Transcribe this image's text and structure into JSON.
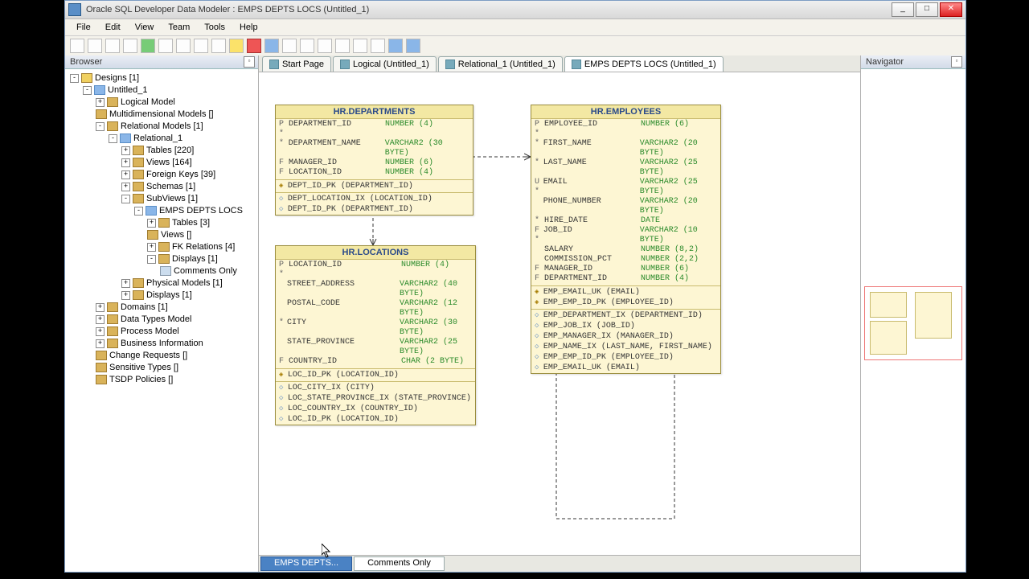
{
  "window": {
    "title": "Oracle SQL Developer Data Modeler : EMPS DEPTS LOCS (Untitled_1)"
  },
  "menu": {
    "file": "File",
    "edit": "Edit",
    "view": "View",
    "team": "Team",
    "tools": "Tools",
    "help": "Help"
  },
  "panels": {
    "browser": "Browser",
    "navigator": "Navigator"
  },
  "tabs": {
    "start": "Start Page",
    "logical": "Logical (Untitled_1)",
    "rel": "Relational_1 (Untitled_1)",
    "subv": "EMPS DEPTS LOCS (Untitled_1)"
  },
  "bottom": {
    "t1": "EMPS DEPTS...",
    "t2": "Comments Only"
  },
  "tree": {
    "designs": "Designs [1]",
    "untitled": "Untitled_1",
    "logical": "Logical Model",
    "multi": "Multidimensional Models []",
    "relmodels": "Relational Models [1]",
    "rel1": "Relational_1",
    "tables": "Tables [220]",
    "views": "Views [164]",
    "fkeys": "Foreign Keys [39]",
    "schemas": "Schemas [1]",
    "subviews": "SubViews [1]",
    "emps": "EMPS DEPTS LOCS",
    "subtables": "Tables [3]",
    "subviewsn": "Views []",
    "fkrel": "FK Relations [4]",
    "displays": "Displays [1]",
    "comments": "Comments Only",
    "physical": "Physical Models [1]",
    "displays2": "Displays [1]",
    "domains": "Domains [1]",
    "datatypes": "Data Types Model",
    "process": "Process Model",
    "business": "Business Information",
    "changes": "Change Requests []",
    "sensitive": "Sensitive Types []",
    "tsdp": "TSDP Policies []"
  },
  "ent": {
    "depts": {
      "title": "HR.DEPARTMENTS",
      "cols": [
        {
          "f": "P *",
          "n": "DEPARTMENT_ID",
          "t": "NUMBER (4)"
        },
        {
          "f": "  *",
          "n": "DEPARTMENT_NAME",
          "t": "VARCHAR2 (30 BYTE)"
        },
        {
          "f": "F",
          "n": "MANAGER_ID",
          "t": "NUMBER (6)"
        },
        {
          "f": "F",
          "n": "LOCATION_ID",
          "t": "NUMBER (4)"
        }
      ],
      "pk": "DEPT_ID_PK (DEPARTMENT_ID)",
      "idx": [
        "DEPT_LOCATION_IX (LOCATION_ID)",
        "DEPT_ID_PK (DEPARTMENT_ID)"
      ]
    },
    "emps": {
      "title": "HR.EMPLOYEES",
      "cols": [
        {
          "f": "P *",
          "n": "EMPLOYEE_ID",
          "t": "NUMBER (6)"
        },
        {
          "f": "  *",
          "n": "FIRST_NAME",
          "t": "VARCHAR2 (20 BYTE)"
        },
        {
          "f": "  *",
          "n": "LAST_NAME",
          "t": "VARCHAR2 (25 BYTE)"
        },
        {
          "f": "U *",
          "n": "EMAIL",
          "t": "VARCHAR2 (25 BYTE)"
        },
        {
          "f": "",
          "n": "PHONE_NUMBER",
          "t": "VARCHAR2 (20 BYTE)"
        },
        {
          "f": "  *",
          "n": "HIRE_DATE",
          "t": "DATE"
        },
        {
          "f": "F *",
          "n": "JOB_ID",
          "t": "VARCHAR2 (10 BYTE)"
        },
        {
          "f": "",
          "n": "SALARY",
          "t": "NUMBER (8,2)"
        },
        {
          "f": "",
          "n": "COMMISSION_PCT",
          "t": "NUMBER (2,2)"
        },
        {
          "f": "F",
          "n": "MANAGER_ID",
          "t": "NUMBER (6)"
        },
        {
          "f": "F",
          "n": "DEPARTMENT_ID",
          "t": "NUMBER (4)"
        }
      ],
      "uk": [
        "EMP_EMAIL_UK (EMAIL)",
        "EMP_EMP_ID_PK (EMPLOYEE_ID)"
      ],
      "idx": [
        "EMP_DEPARTMENT_IX (DEPARTMENT_ID)",
        "EMP_JOB_IX (JOB_ID)",
        "EMP_MANAGER_IX (MANAGER_ID)",
        "EMP_NAME_IX (LAST_NAME, FIRST_NAME)",
        "EMP_EMP_ID_PK (EMPLOYEE_ID)",
        "EMP_EMAIL_UK (EMAIL)"
      ]
    },
    "locs": {
      "title": "HR.LOCATIONS",
      "cols": [
        {
          "f": "P *",
          "n": "LOCATION_ID",
          "t": "NUMBER (4)"
        },
        {
          "f": "",
          "n": "STREET_ADDRESS",
          "t": "VARCHAR2 (40 BYTE)"
        },
        {
          "f": "",
          "n": "POSTAL_CODE",
          "t": "VARCHAR2 (12 BYTE)"
        },
        {
          "f": "  *",
          "n": "CITY",
          "t": "VARCHAR2 (30 BYTE)"
        },
        {
          "f": "",
          "n": "STATE_PROVINCE",
          "t": "VARCHAR2 (25 BYTE)"
        },
        {
          "f": "F",
          "n": "COUNTRY_ID",
          "t": "CHAR (2 BYTE)"
        }
      ],
      "pk": "LOC_ID_PK (LOCATION_ID)",
      "idx": [
        "LOC_CITY_IX (CITY)",
        "LOC_STATE_PROVINCE_IX (STATE_PROVINCE)",
        "LOC_COUNTRY_IX (COUNTRY_ID)",
        "LOC_ID_PK (LOCATION_ID)"
      ]
    }
  }
}
